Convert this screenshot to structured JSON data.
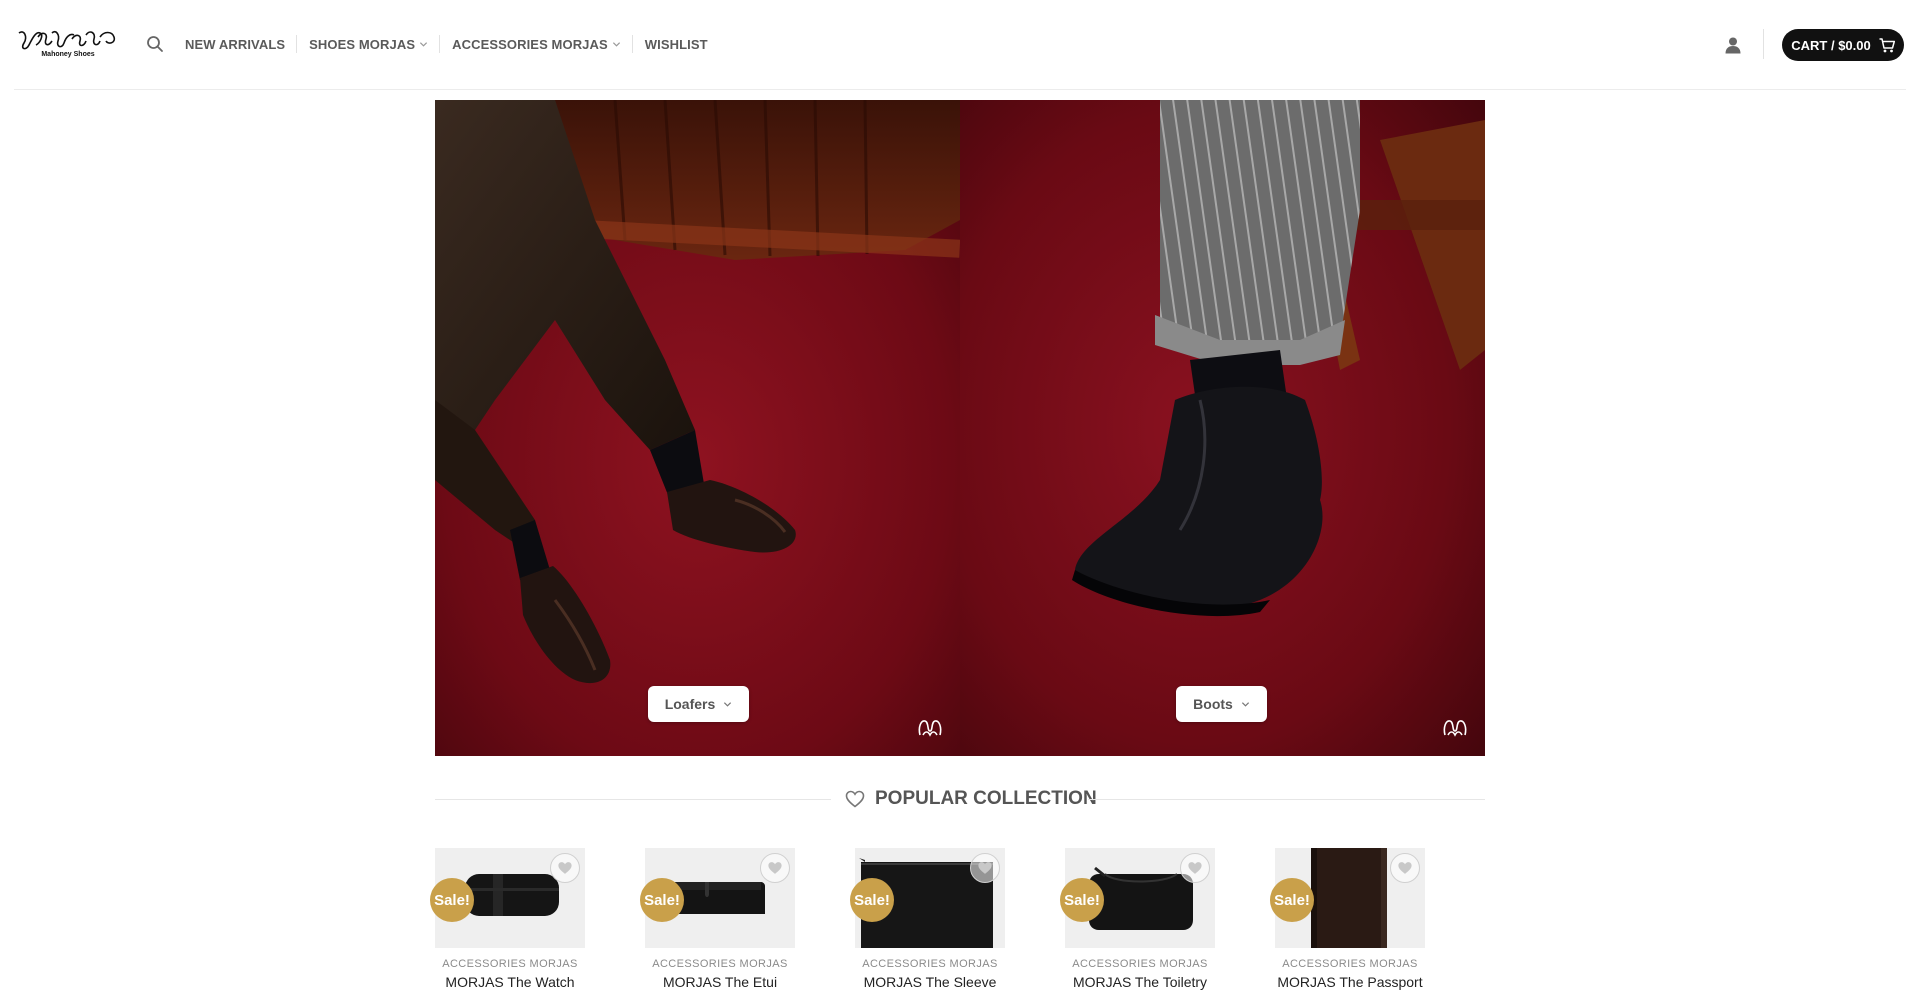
{
  "brand": {
    "logo_subtitle": "Mahoney Shoes",
    "logo_icon": "morjas-logo-icon"
  },
  "header": {
    "search_icon": "search-icon",
    "nav": [
      {
        "label": "NEW ARRIVALS",
        "has_dropdown": false
      },
      {
        "label": "SHOES MORJAS",
        "has_dropdown": true
      },
      {
        "label": "ACCESSORIES MORJAS",
        "has_dropdown": true
      },
      {
        "label": "WISHLIST",
        "has_dropdown": false
      }
    ],
    "account_icon": "user-icon",
    "cart_label": "CART / $0.00",
    "cart_icon": "cart-icon"
  },
  "hero": {
    "panels": [
      {
        "button_label": "Loafers"
      },
      {
        "button_label": "Boots"
      }
    ]
  },
  "section": {
    "title": "POPULAR COLLECTION",
    "icon": "heart-icon"
  },
  "products": [
    {
      "category": "ACCESSORIES MORJAS",
      "name": "MORJAS The Watch",
      "badge": "Sale!"
    },
    {
      "category": "ACCESSORIES MORJAS",
      "name": "MORJAS The Etui",
      "badge": "Sale!"
    },
    {
      "category": "ACCESSORIES MORJAS",
      "name": "MORJAS The Sleeve",
      "badge": "Sale!"
    },
    {
      "category": "ACCESSORIES MORJAS",
      "name": "MORJAS The Toiletry",
      "badge": "Sale!"
    },
    {
      "category": "ACCESSORIES MORJAS",
      "name": "MORJAS The Passport",
      "badge": "Sale!"
    }
  ],
  "colors": {
    "carpet": "#7a0b16",
    "sale_badge": "#c9a04a",
    "cart_bg": "#111111"
  }
}
